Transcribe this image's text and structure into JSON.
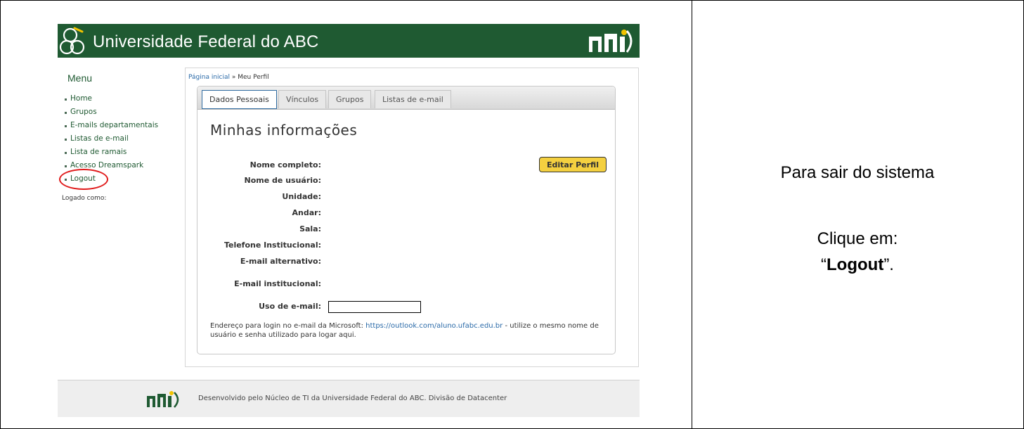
{
  "header": {
    "title": "Universidade Federal do ABC",
    "color": "#1f5a32"
  },
  "menu": {
    "title": "Menu",
    "items": [
      {
        "label": "Home"
      },
      {
        "label": "Grupos"
      },
      {
        "label": "E-mails departamentais"
      },
      {
        "label": "Listas de e-mail"
      },
      {
        "label": "Lista de ramais"
      },
      {
        "label": "Acesso Dreamspark"
      },
      {
        "label": "Logout"
      }
    ],
    "logged_as": "Logado como:"
  },
  "breadcrumb": {
    "home": "Página inicial",
    "separator": " » ",
    "current": "Meu Perfil"
  },
  "tabs": [
    {
      "label": "Dados Pessoais",
      "active": true
    },
    {
      "label": "Vínculos"
    },
    {
      "label": "Grupos"
    },
    {
      "label": "Listas de e-mail"
    }
  ],
  "profile": {
    "title": "Minhas informações",
    "edit_button": "Editar Perfil",
    "fields": [
      "Nome completo:",
      "Nome de usuário:",
      "Unidade:",
      "Andar:",
      "Sala:",
      "Telefone Institucional:",
      "E-mail alternativo:",
      "E-mail institucional:",
      "Uso de e-mail:"
    ],
    "note_prefix": "Endereço para login no e-mail da Microsoft: ",
    "note_link": "https://outlook.com/aluno.ufabc.edu.br",
    "note_suffix": " - utilize o mesmo nome de usuário e senha utilizado para logar aqui."
  },
  "footer": {
    "text": "Desenvolvido pelo Núcleo de TI da Universidade Federal do ABC. Divisão de Datacenter"
  },
  "instructions": {
    "line1": "Para sair do sistema",
    "line2": "Clique em:",
    "line3_open": "“",
    "line3_bold": "Logout",
    "line3_close": "”."
  },
  "icons": [
    "ufabc-rings-logo",
    "nti-logo"
  ],
  "accent_colors": {
    "header_green": "#1f5a32",
    "button_yellow": "#f4d040",
    "logout_highlight": "#e01b1b",
    "link_blue": "#2a6aa8"
  }
}
